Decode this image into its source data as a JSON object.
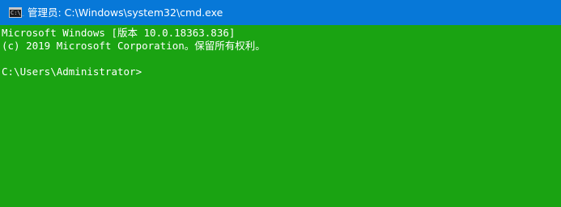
{
  "window": {
    "title": "管理员: C:\\Windows\\system32\\cmd.exe",
    "icon": "cmd-icon",
    "icon_glyph": "C:\\_"
  },
  "console": {
    "lines": [
      "Microsoft Windows [版本 10.0.18363.836]",
      "(c) 2019 Microsoft Corporation。保留所有权利。",
      ""
    ],
    "prompt": "C:\\Users\\Administrator>"
  },
  "colors": {
    "titlebar": "#0778d8",
    "console_background": "#1aa312",
    "console_text": "#ffffff"
  }
}
